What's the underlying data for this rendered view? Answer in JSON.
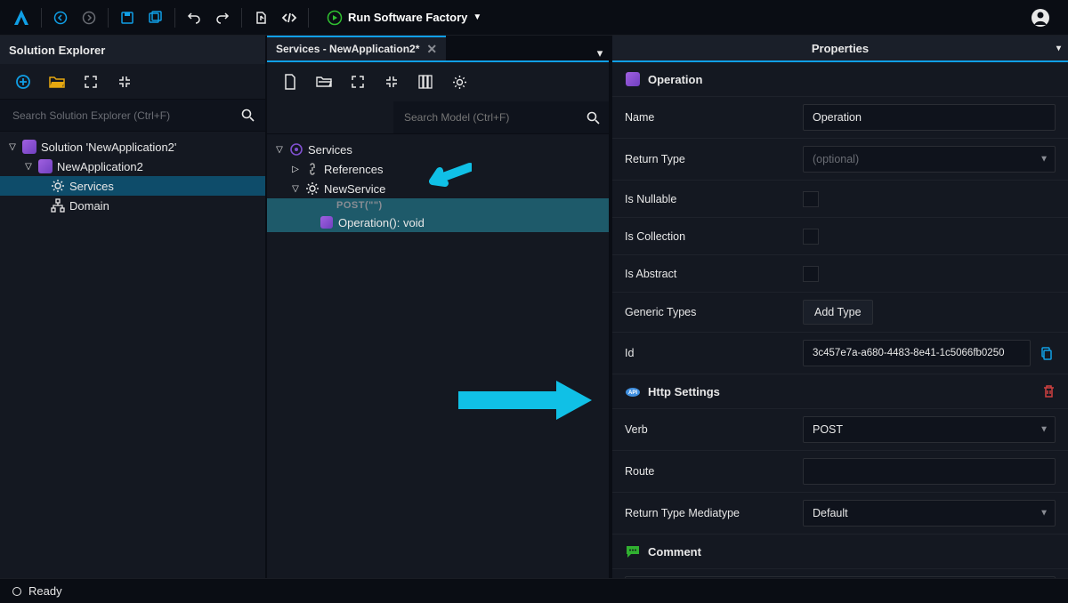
{
  "topbar": {
    "run_label": "Run Software Factory"
  },
  "solution_explorer": {
    "title": "Solution Explorer",
    "search_placeholder": "Search Solution Explorer (Ctrl+F)",
    "tree": {
      "root": "Solution 'NewApplication2'",
      "app": "NewApplication2",
      "services": "Services",
      "domain": "Domain"
    }
  },
  "services_tab": {
    "title": "Services - NewApplication2*",
    "search_placeholder": "Search Model (Ctrl+F)",
    "tree": {
      "root": "Services",
      "references": "References",
      "service": "NewService",
      "op_verb_badge": "POST(\"\")",
      "op_label": "Operation(): void"
    }
  },
  "properties": {
    "title": "Properties",
    "groups": {
      "operation": {
        "title": "Operation",
        "name_label": "Name",
        "name_value": "Operation",
        "return_type_label": "Return Type",
        "return_type_placeholder": "(optional)",
        "is_nullable_label": "Is Nullable",
        "is_collection_label": "Is Collection",
        "is_abstract_label": "Is Abstract",
        "generic_types_label": "Generic Types",
        "add_type_btn": "Add Type",
        "id_label": "Id",
        "id_value": "3c457e7a-a680-4483-8e41-1c5066fb0250"
      },
      "http": {
        "title": "Http Settings",
        "verb_label": "Verb",
        "verb_value": "POST",
        "route_label": "Route",
        "return_mt_label": "Return Type Mediatype",
        "return_mt_value": "Default"
      },
      "comment": {
        "title": "Comment"
      }
    }
  },
  "statusbar": {
    "text": "Ready"
  }
}
